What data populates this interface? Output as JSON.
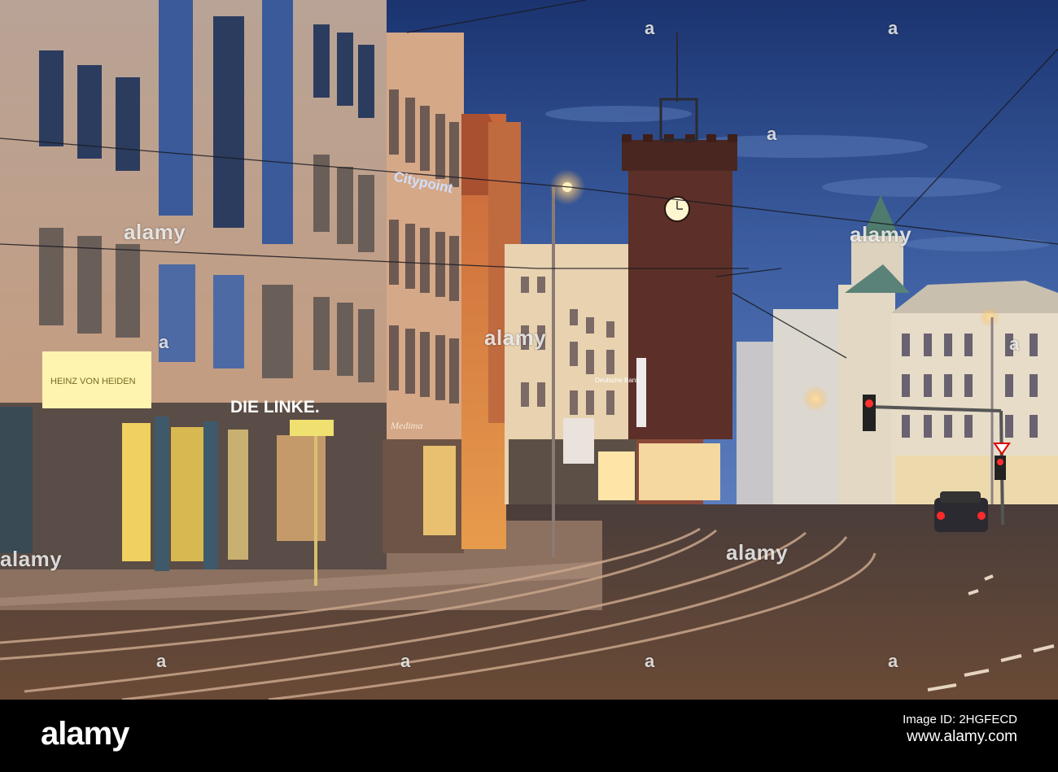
{
  "photo": {
    "signs": {
      "heinz": "HEINZ VON HEIDEN",
      "dielinke": "DIE LINKE.",
      "citypoint": "Citypoint",
      "bank": "Deutsche Bank",
      "shop": "Medima"
    }
  },
  "watermarks": {
    "brand": "alamy",
    "letter": "a"
  },
  "footer": {
    "logo": "alamy",
    "image_id_label": "Image ID: 2HGFECD",
    "url": "www.alamy.com"
  },
  "colors": {
    "sky_top": "#1b3a78",
    "sky_bottom": "#4a6fb0",
    "street_light": "#ffb347",
    "footer_bg": "#000000"
  }
}
